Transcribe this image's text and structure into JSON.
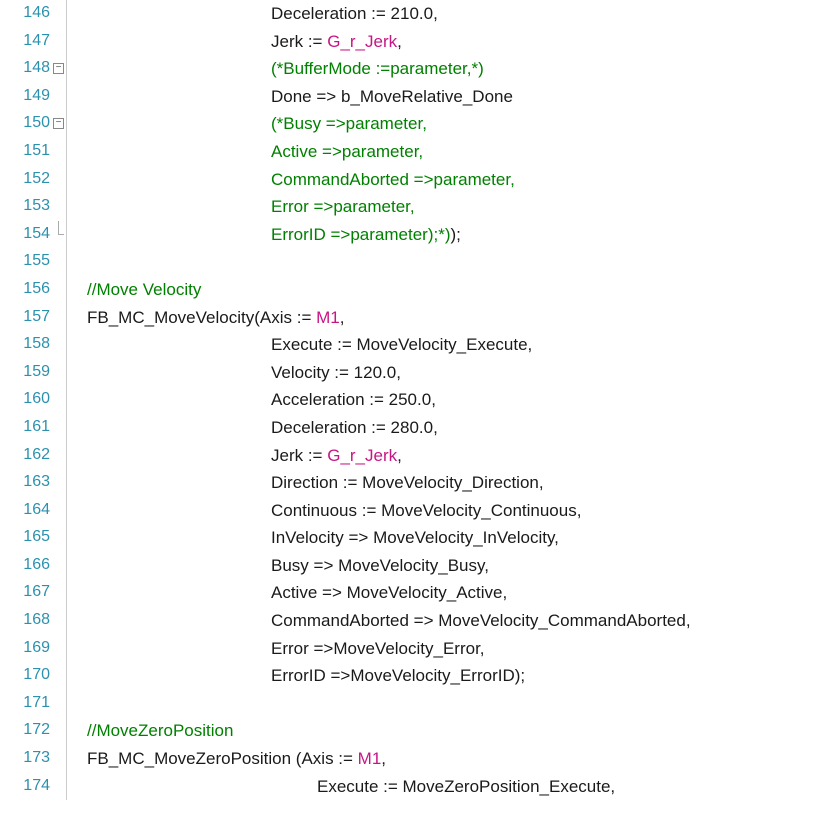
{
  "lines": [
    {
      "num": 146,
      "fold": "v",
      "indent": 200,
      "tokens": [
        [
          "Deceleration := 210.0,",
          "plain"
        ]
      ]
    },
    {
      "num": 147,
      "fold": "v",
      "indent": 200,
      "tokens": [
        [
          "Jerk := ",
          "plain"
        ],
        [
          "G_r_Jerk",
          "pink"
        ],
        [
          ",",
          "plain"
        ]
      ]
    },
    {
      "num": 148,
      "fold": "box",
      "indent": 200,
      "tokens": [
        [
          "(*BufferMode :=parameter,*)",
          "comment"
        ]
      ]
    },
    {
      "num": 149,
      "fold": "v",
      "indent": 200,
      "tokens": [
        [
          "Done => b_MoveRelative_Done",
          "plain"
        ]
      ]
    },
    {
      "num": 150,
      "fold": "box",
      "indent": 200,
      "tokens": [
        [
          "(*Busy =>parameter,",
          "comment"
        ]
      ]
    },
    {
      "num": 151,
      "fold": "v",
      "indent": 200,
      "tokens": [
        [
          "Active =>parameter,",
          "comment"
        ]
      ]
    },
    {
      "num": 152,
      "fold": "v",
      "indent": 200,
      "tokens": [
        [
          "CommandAborted =>parameter,",
          "comment"
        ]
      ]
    },
    {
      "num": 153,
      "fold": "v",
      "indent": 200,
      "tokens": [
        [
          "Error =>parameter,",
          "comment"
        ]
      ]
    },
    {
      "num": 154,
      "fold": "end",
      "indent": 200,
      "tokens": [
        [
          "ErrorID =>parameter);*)",
          "comment"
        ],
        [
          ");",
          "plain"
        ]
      ]
    },
    {
      "num": 155,
      "fold": "",
      "indent": 0,
      "tokens": [
        [
          "",
          "plain"
        ]
      ]
    },
    {
      "num": 156,
      "fold": "",
      "indent": 16,
      "tokens": [
        [
          "//Move Velocity",
          "comment"
        ]
      ]
    },
    {
      "num": 157,
      "fold": "",
      "indent": 16,
      "tokens": [
        [
          "FB_MC_MoveVelocity(Axis := ",
          "plain"
        ],
        [
          "M1",
          "pink"
        ],
        [
          ",",
          "plain"
        ]
      ]
    },
    {
      "num": 158,
      "fold": "",
      "indent": 200,
      "tokens": [
        [
          "Execute := MoveVelocity_Execute,",
          "plain"
        ]
      ]
    },
    {
      "num": 159,
      "fold": "",
      "indent": 200,
      "tokens": [
        [
          "Velocity := 120.0,",
          "plain"
        ]
      ]
    },
    {
      "num": 160,
      "fold": "",
      "indent": 200,
      "tokens": [
        [
          "Acceleration := 250.0,",
          "plain"
        ]
      ]
    },
    {
      "num": 161,
      "fold": "",
      "indent": 200,
      "tokens": [
        [
          "Deceleration := 280.0,",
          "plain"
        ]
      ]
    },
    {
      "num": 162,
      "fold": "",
      "indent": 200,
      "tokens": [
        [
          "Jerk := ",
          "plain"
        ],
        [
          "G_r_Jerk",
          "pink"
        ],
        [
          ",",
          "plain"
        ]
      ]
    },
    {
      "num": 163,
      "fold": "",
      "indent": 200,
      "tokens": [
        [
          "Direction := MoveVelocity_Direction,",
          "plain"
        ]
      ]
    },
    {
      "num": 164,
      "fold": "",
      "indent": 200,
      "tokens": [
        [
          "Continuous := MoveVelocity_Continuous,",
          "plain"
        ]
      ]
    },
    {
      "num": 165,
      "fold": "",
      "indent": 200,
      "tokens": [
        [
          "InVelocity => MoveVelocity_InVelocity,",
          "plain"
        ]
      ]
    },
    {
      "num": 166,
      "fold": "",
      "indent": 200,
      "tokens": [
        [
          "Busy => MoveVelocity_Busy,",
          "plain"
        ]
      ]
    },
    {
      "num": 167,
      "fold": "",
      "indent": 200,
      "tokens": [
        [
          "Active => MoveVelocity_Active,",
          "plain"
        ]
      ]
    },
    {
      "num": 168,
      "fold": "",
      "indent": 200,
      "tokens": [
        [
          "CommandAborted => MoveVelocity_CommandAborted,",
          "plain"
        ]
      ]
    },
    {
      "num": 169,
      "fold": "",
      "indent": 200,
      "tokens": [
        [
          "Error =>MoveVelocity_Error,",
          "plain"
        ]
      ]
    },
    {
      "num": 170,
      "fold": "",
      "indent": 200,
      "tokens": [
        [
          "ErrorID =>MoveVelocity_ErrorID);",
          "plain"
        ]
      ]
    },
    {
      "num": 171,
      "fold": "",
      "indent": 0,
      "tokens": [
        [
          "",
          "plain"
        ]
      ]
    },
    {
      "num": 172,
      "fold": "",
      "indent": 16,
      "tokens": [
        [
          "//MoveZeroPosition",
          "comment"
        ]
      ]
    },
    {
      "num": 173,
      "fold": "",
      "indent": 16,
      "tokens": [
        [
          "FB_MC_MoveZeroPosition (Axis := ",
          "plain"
        ],
        [
          "M1",
          "pink"
        ],
        [
          ",",
          "plain"
        ]
      ]
    },
    {
      "num": 174,
      "fold": "",
      "indent": 246,
      "tokens": [
        [
          "Execute := MoveZeroPosition_Execute,",
          "plain"
        ]
      ]
    }
  ]
}
